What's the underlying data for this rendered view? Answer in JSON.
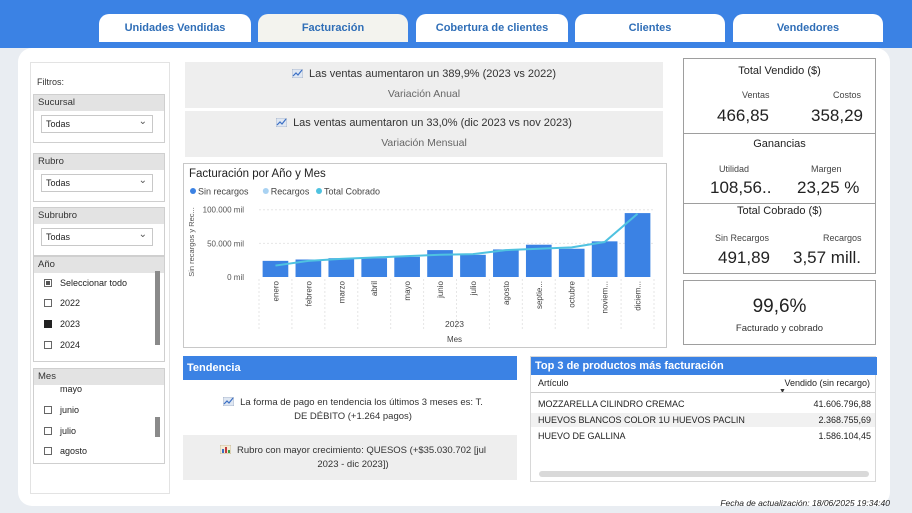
{
  "tabs": [
    "Unidades Vendidas",
    "Facturación",
    "Cobertura de clientes",
    "Clientes",
    "Vendedores"
  ],
  "filters": {
    "title": "Filtros:",
    "sucursal": {
      "label": "Sucursal",
      "value": "Todas"
    },
    "rubro": {
      "label": "Rubro",
      "value": "Todas"
    },
    "subrubro": {
      "label": "Subrubro",
      "value": "Todas"
    },
    "anio": {
      "label": "Año",
      "items": [
        "Seleccionar todo",
        "2022",
        "2023",
        "2024"
      ]
    },
    "mes": {
      "label": "Mes",
      "items": [
        "mayo",
        "junio",
        "julio",
        "agosto"
      ]
    }
  },
  "variacion_anual": {
    "text": "Las ventas aumentaron un 389,9% (2023 vs 2022)",
    "label": "Variación Anual"
  },
  "variacion_mensual": {
    "text": "Las ventas aumentaron un 33,0% (dic 2023 vs nov 2023)",
    "label": "Variación Mensual"
  },
  "chart_data": {
    "type": "bar",
    "title": "Facturación por Año y Mes",
    "legend": [
      "Sin recargos",
      "Recargos",
      "Total Cobrado"
    ],
    "colors": {
      "sin_recargos": "#3b82e4",
      "recargos": "#a9d2f2",
      "total_cobrado": "#4fc2e0"
    },
    "ylabel": "Sin recargos y Rec...",
    "xlabel": "Mes",
    "year_label": "2023",
    "ylim": [
      0,
      110000
    ],
    "yticks": [
      "100.000 mil",
      "50.000 mil",
      "0 mil"
    ],
    "ytick_values": [
      100000,
      50000,
      0
    ],
    "categories": [
      "enero",
      "febrero",
      "marzo",
      "abril",
      "mayo",
      "junio",
      "julio",
      "agosto",
      "septie...",
      "octubre",
      "noviem...",
      "diciem..."
    ],
    "series": [
      {
        "name": "Sin recargos",
        "values": [
          24000,
          26000,
          28000,
          28000,
          30000,
          40000,
          33000,
          41000,
          48000,
          42000,
          53000,
          95000
        ]
      },
      {
        "name": "Total Cobrado",
        "values": [
          17000,
          24000,
          27000,
          29000,
          31000,
          33000,
          34000,
          40000,
          42000,
          44000,
          52000,
          94000
        ]
      }
    ]
  },
  "kpi": {
    "total_vendido": {
      "title": "Total Vendido ($)",
      "ventas_label": "Ventas",
      "ventas": "466,85",
      "costos_label": "Costos",
      "costos": "358,29"
    },
    "ganancias": {
      "title": "Ganancias",
      "utilidad_label": "Utilidad",
      "utilidad": "108,56..",
      "margen_label": "Margen",
      "margen": "23,25 %"
    },
    "total_cobrado": {
      "title": "Total Cobrado ($)",
      "sin_label": "Sin Recargos",
      "sin": "491,89",
      "rec_label": "Recargos",
      "rec": "3,57 mill."
    },
    "facturado": {
      "value": "99,6%",
      "label": "Facturado y cobrado"
    }
  },
  "tendencia": {
    "title": "Tendencia",
    "line1": "La forma de pago en tendencia los últimos 3 meses es: T.",
    "line1b": "DE DÉBITO (+1.264 pagos)",
    "line2": "Rubro con mayor crecimiento: QUESOS (+$35.030.702 [jul",
    "line2b": "2023 - dic 2023])"
  },
  "top3": {
    "title": "Top 3 de productos más facturación",
    "col1": "Artículo",
    "col2": "Vendido (sin recargo)",
    "rows": [
      {
        "name": "MOZZARELLA CILINDRO CREMAC",
        "value": "41.606.796,88"
      },
      {
        "name": "HUEVOS BLANCOS COLOR 1U HUEVOS PACLIN",
        "value": "2.368.755,69"
      },
      {
        "name": "HUEVO DE GALLINA",
        "value": "1.586.104,45"
      }
    ]
  },
  "footer": "Fecha de actualización: 18/06/2025 19:34:40"
}
